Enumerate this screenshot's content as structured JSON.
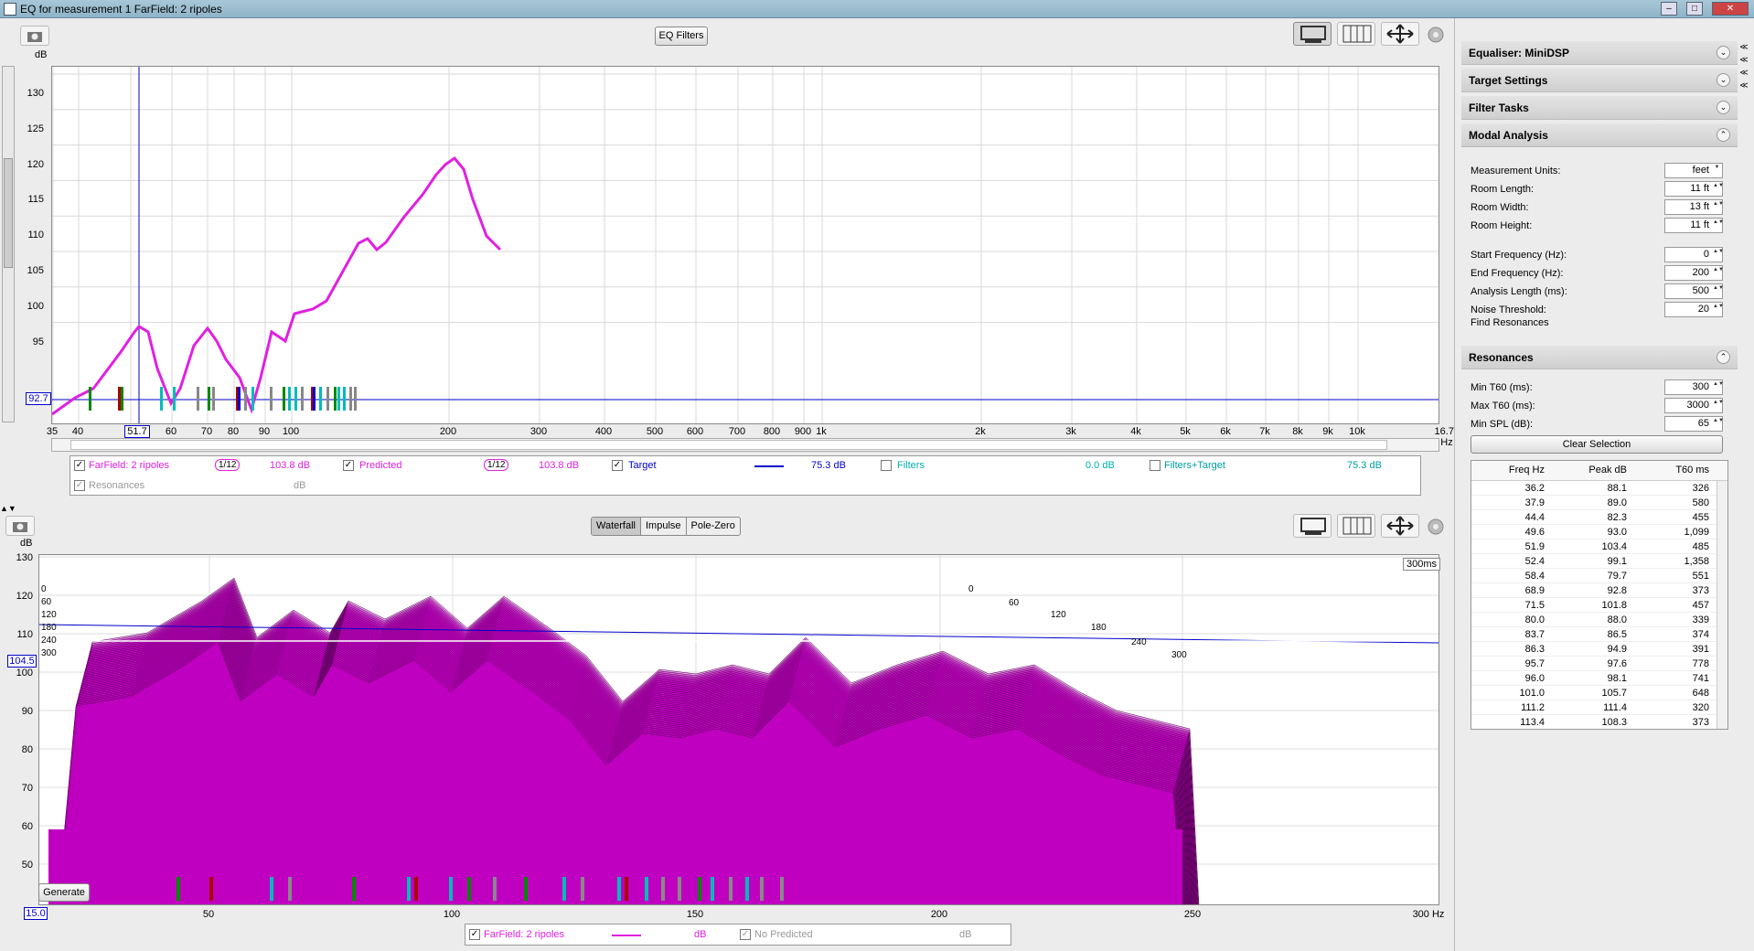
{
  "window": {
    "title": "EQ for measurement 1 FarField: 2 ripoles"
  },
  "top": {
    "eq_filters_btn": "EQ Filters",
    "y_unit": "dB",
    "y_ticks": [
      "130",
      "125",
      "120",
      "115",
      "110",
      "105",
      "100",
      "95"
    ],
    "marker_value": "92.7",
    "x_ticks": [
      "35",
      "40",
      "50",
      "60",
      "70",
      "80",
      "90",
      "100",
      "200",
      "300",
      "400",
      "500",
      "600",
      "700",
      "800",
      "900",
      "1k",
      "2k",
      "3k",
      "4k",
      "5k",
      "6k",
      "7k",
      "8k",
      "9k",
      "10k",
      "16.7k Hz"
    ],
    "cursor_x": "51.7"
  },
  "legend_top": {
    "items": [
      {
        "label": "FarField: 2 ripoles",
        "smoothing": "1/12",
        "value": "103.8 dB",
        "checked": true,
        "color": "#e020e0"
      },
      {
        "label": "Predicted",
        "smoothing": "1/12",
        "value": "103.8 dB",
        "checked": true,
        "color": "#e020e0"
      },
      {
        "label": "Target",
        "value": "75.3 dB",
        "checked": true,
        "color": "#0000cc"
      },
      {
        "label": "Filters",
        "value": "0.0 dB",
        "checked": false,
        "color": "#00b0b0"
      },
      {
        "label": "Filters+Target",
        "value": "75.3 dB",
        "checked": false,
        "color": "#00a0a0"
      },
      {
        "label": "Resonances",
        "value": "dB",
        "checked": true,
        "color": "#999999"
      }
    ]
  },
  "bottom": {
    "tabs": [
      "Waterfall",
      "Impulse",
      "Pole-Zero"
    ],
    "active_tab": "Waterfall",
    "y_unit": "dB",
    "y_ticks": [
      "130",
      "120",
      "110",
      "100",
      "90",
      "80",
      "70",
      "60",
      "50"
    ],
    "marker_value": "104.5",
    "x_start": "15.0",
    "x_ticks": [
      "50",
      "100",
      "150",
      "200",
      "250",
      "300 Hz"
    ],
    "time_label": "300ms",
    "time_ticks": [
      "0",
      "60",
      "120",
      "180",
      "240",
      "300"
    ],
    "generate_btn": "Generate",
    "legend": [
      {
        "label": "FarField: 2 ripoles",
        "value": "dB",
        "checked": true
      },
      {
        "label": "No Predicted",
        "value": "dB",
        "checked": true
      }
    ]
  },
  "sidebar": {
    "sections": [
      "Equaliser: MiniDSP",
      "Target Settings",
      "Filter Tasks",
      "Modal Analysis"
    ],
    "modal": {
      "fields": [
        {
          "label": "Measurement Units:",
          "value": "feet"
        },
        {
          "label": "Room Length:",
          "value": "11 ft"
        },
        {
          "label": "Room Width:",
          "value": "13 ft"
        },
        {
          "label": "Room Height:",
          "value": "11 ft"
        },
        {
          "label": "Start Frequency (Hz):",
          "value": "0"
        },
        {
          "label": "End Frequency (Hz):",
          "value": "200"
        },
        {
          "label": "Analysis Length (ms):",
          "value": "500"
        },
        {
          "label": "Noise Threshold:",
          "value": "20"
        }
      ],
      "find_label": "Find Resonances"
    },
    "resonances": {
      "title": "Resonances",
      "fields": [
        {
          "label": "Min T60 (ms):",
          "value": "300"
        },
        {
          "label": "Max T60 (ms):",
          "value": "3000"
        },
        {
          "label": "Min SPL (dB):",
          "value": "65"
        }
      ],
      "clear_btn": "Clear Selection",
      "headers": [
        "Freq Hz",
        "Peak dB",
        "T60 ms"
      ],
      "rows": [
        [
          "36.2",
          "88.1",
          "326"
        ],
        [
          "37.9",
          "89.0",
          "580"
        ],
        [
          "44.4",
          "82.3",
          "455"
        ],
        [
          "49.6",
          "93.0",
          "1,099"
        ],
        [
          "51.9",
          "103.4",
          "485"
        ],
        [
          "52.4",
          "99.1",
          "1,358"
        ],
        [
          "58.4",
          "79.7",
          "551"
        ],
        [
          "68.9",
          "92.8",
          "373"
        ],
        [
          "71.5",
          "101.8",
          "457"
        ],
        [
          "80.0",
          "88.0",
          "339"
        ],
        [
          "83.7",
          "86.5",
          "374"
        ],
        [
          "86.3",
          "94.9",
          "391"
        ],
        [
          "95.7",
          "97.6",
          "778"
        ],
        [
          "96.0",
          "98.1",
          "741"
        ],
        [
          "101.0",
          "105.7",
          "648"
        ],
        [
          "111.2",
          "111.4",
          "320"
        ],
        [
          "113.4",
          "108.3",
          "373"
        ]
      ]
    }
  },
  "colors": {
    "accent": "#e020e0",
    "target": "#0000cc",
    "waterfall": "#c000c0"
  }
}
